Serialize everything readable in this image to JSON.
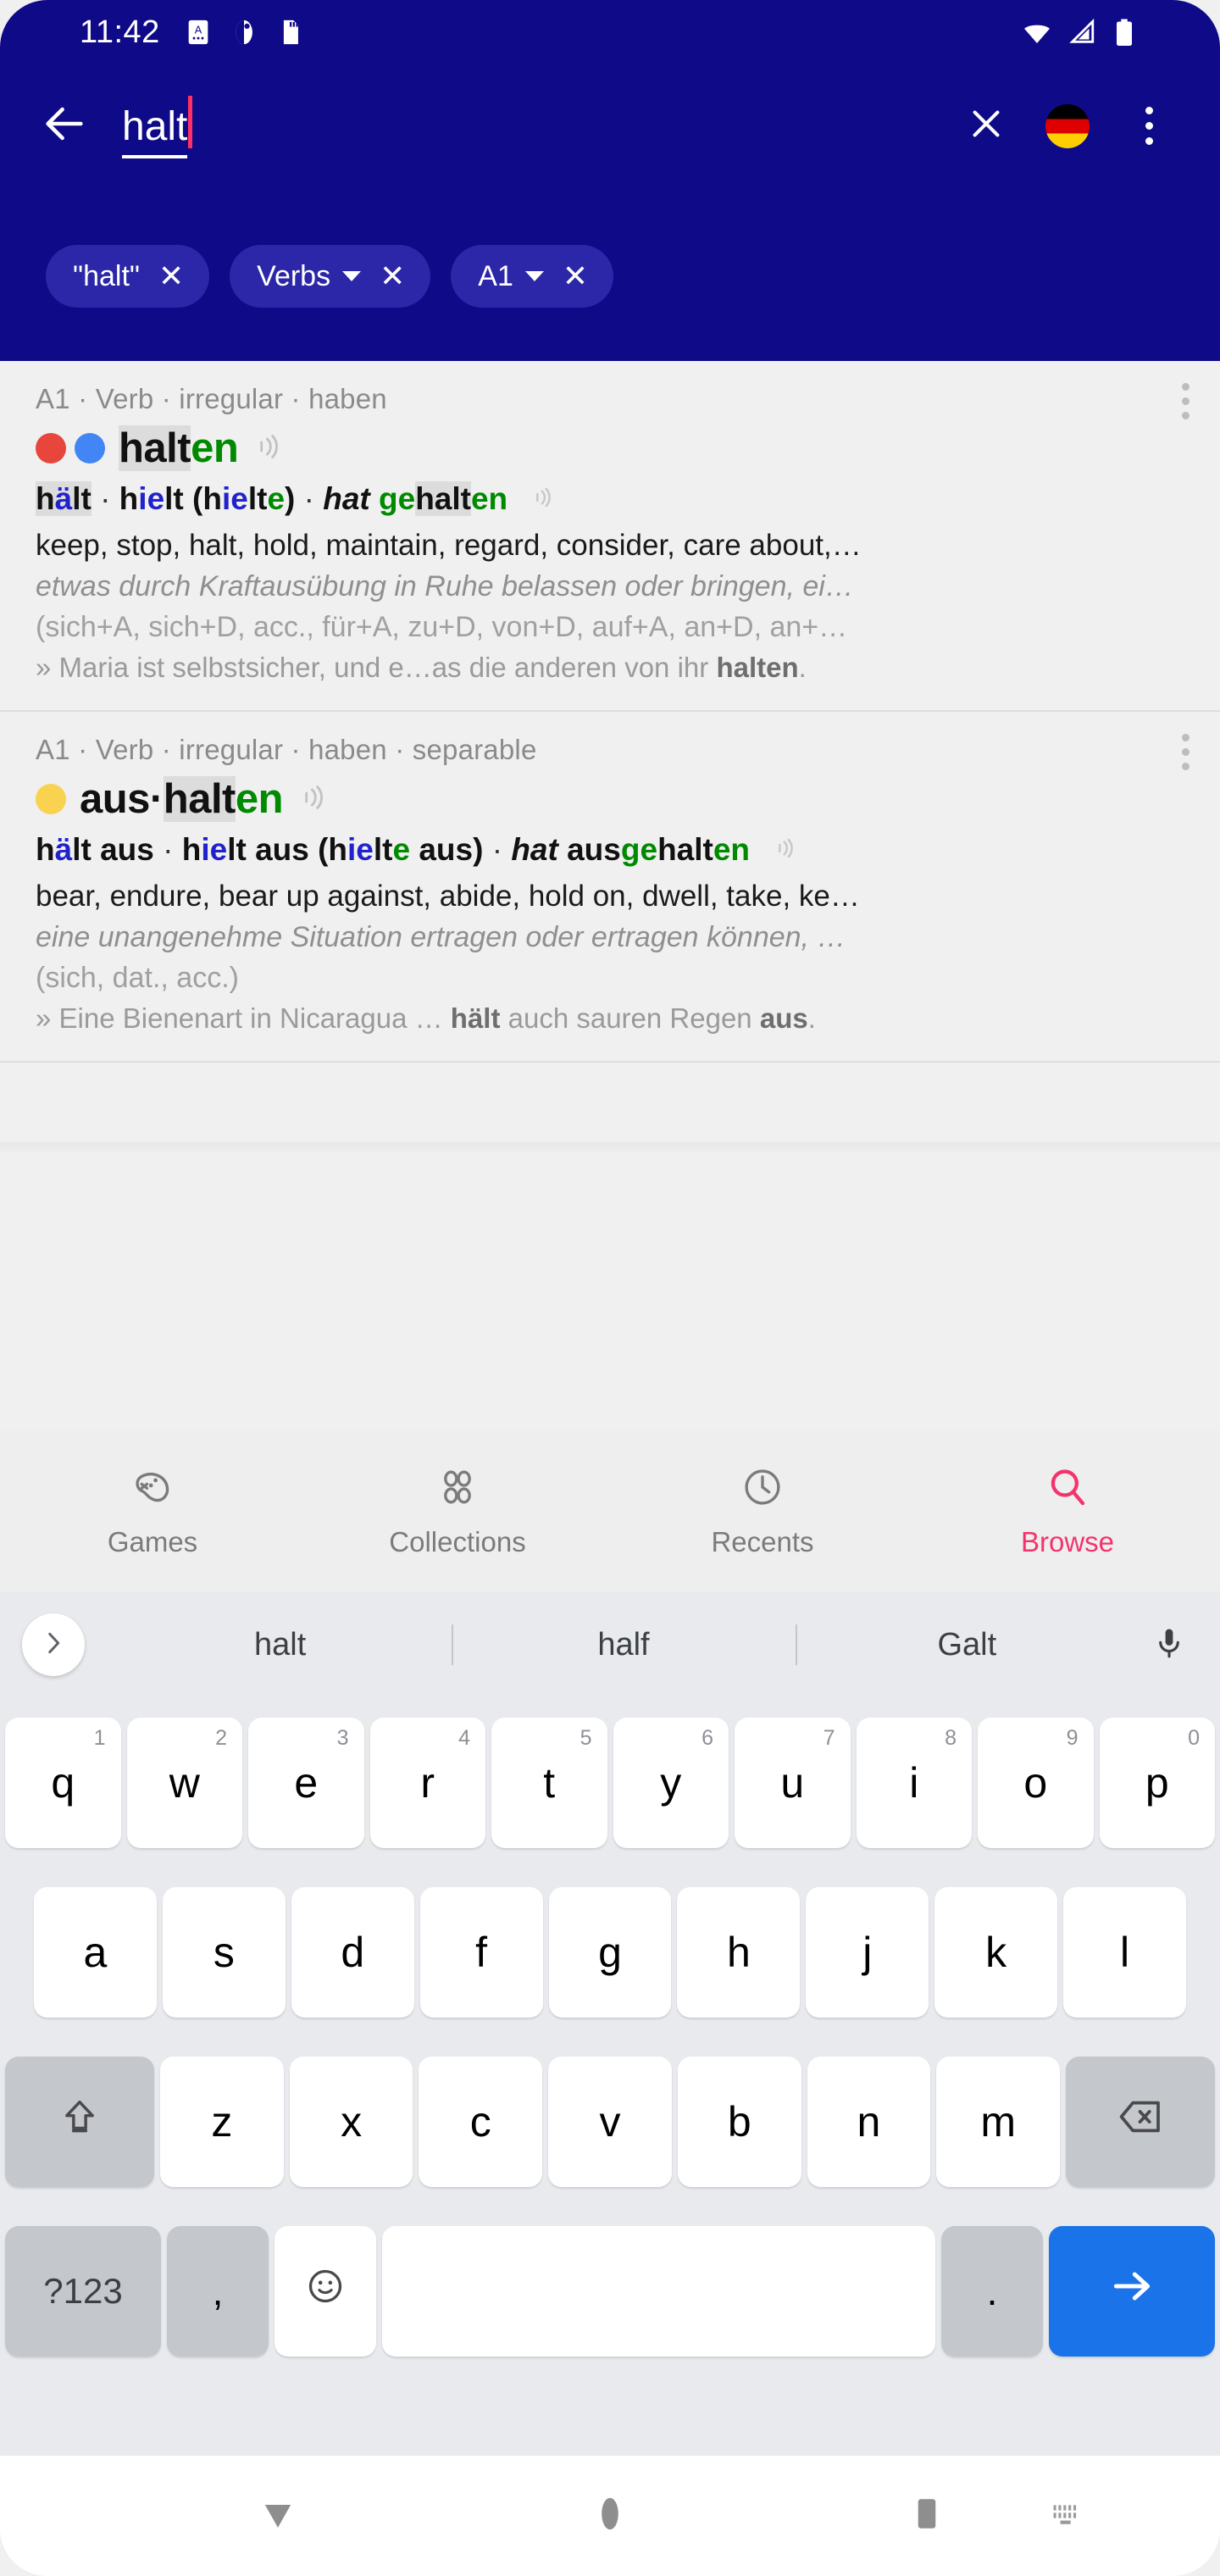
{
  "statusbar": {
    "time": "11:42",
    "left_icons": [
      "sd-card-a-icon",
      "mask-icon",
      "sim-card-icon"
    ],
    "right_icons": [
      "wifi-icon",
      "cellular-signal-icon",
      "battery-icon"
    ]
  },
  "appbar": {
    "back_icon": "back-arrow-icon",
    "query": "halt",
    "clear_icon": "close-icon",
    "language_icon": "german-flag-icon",
    "overflow_icon": "more-vertical-icon"
  },
  "filters": [
    {
      "label": "\"halt\"",
      "dropdown": false,
      "close": "✕"
    },
    {
      "label": "Verbs",
      "dropdown": true,
      "close": "✕"
    },
    {
      "label": "A1",
      "dropdown": true,
      "close": "✕"
    }
  ],
  "results": [
    {
      "meta": "A1 · Verb · irregular · haben",
      "dots": [
        "red",
        "blue"
      ],
      "headword_parts": [
        {
          "t": "halt",
          "hl": true
        },
        {
          "t": "en",
          "green": true
        }
      ],
      "headword_plain": "halten",
      "forms_html": "h<span class=\"b\">ä</span>lt · h<span class=\"b\">ie</span>lt (h<span class=\"b\">ie</span>lt<span class=\"g\">e</span>) · <span class=\"it\">hat</span> <span class=\"g\">ge</span>halt<span class=\"g\">en</span>",
      "translations": "keep, stop, halt, hold, maintain, regard, consider, care about,…",
      "definition": "etwas durch Kraftausübung in Ruhe belassen oder bringen, ei…",
      "cases": "(sich+A, sich+D, acc., für+A, zu+D, von+D, auf+A, an+D, an+…",
      "example_html": "» Maria ist selbstsicher, und e…as die anderen von ihr <b>halten</b>."
    },
    {
      "meta": "A1 · Verb · irregular · haben · separable",
      "dots": [
        "yellow"
      ],
      "headword_parts": [
        {
          "t": "aus·",
          "hl": false
        },
        {
          "t": "halt",
          "hl": true
        },
        {
          "t": "en",
          "green": true
        }
      ],
      "headword_plain": "aus·halten",
      "forms_html": "h<span class=\"b\">ä</span>lt aus · h<span class=\"b\">ie</span>lt aus (h<span class=\"b\">ie</span>lt<span class=\"g\">e</span> aus) · <span class=\"it\">hat</span> aus<span class=\"g\">ge</span>halt<span class=\"g\">en</span>",
      "translations": "bear, endure, bear up against, abide, hold on, dwell, take, ke…",
      "definition": "eine unangenehme Situation ertragen oder ertragen können, …",
      "cases": "(sich, dat., acc.)",
      "example_html": "» Eine Bienenart in Nicaragua … <b>hält</b> auch sauren Regen <b>aus</b>."
    }
  ],
  "bottomnav": {
    "items": [
      {
        "label": "Games",
        "icon": "gamepad-icon",
        "active": false
      },
      {
        "label": "Collections",
        "icon": "collections-icon",
        "active": false
      },
      {
        "label": "Recents",
        "icon": "clock-icon",
        "active": false
      },
      {
        "label": "Browse",
        "icon": "search-icon",
        "active": true
      }
    ],
    "active_color": "#f4336d",
    "inactive_color": "#7b7b7b"
  },
  "keyboard": {
    "expand_icon": "chevron-right-icon",
    "suggestions": [
      "halt",
      "half",
      "Galt"
    ],
    "mic_icon": "microphone-icon",
    "row1": [
      {
        "k": "q",
        "n": "1"
      },
      {
        "k": "w",
        "n": "2"
      },
      {
        "k": "e",
        "n": "3"
      },
      {
        "k": "r",
        "n": "4"
      },
      {
        "k": "t",
        "n": "5"
      },
      {
        "k": "y",
        "n": "6"
      },
      {
        "k": "u",
        "n": "7"
      },
      {
        "k": "i",
        "n": "8"
      },
      {
        "k": "o",
        "n": "9"
      },
      {
        "k": "p",
        "n": "0"
      }
    ],
    "row2": [
      "a",
      "s",
      "d",
      "f",
      "g",
      "h",
      "j",
      "k",
      "l"
    ],
    "row3": [
      "z",
      "x",
      "c",
      "v",
      "b",
      "n",
      "m"
    ],
    "shift_icon": "shift-icon",
    "backspace_icon": "backspace-icon",
    "sym_label": "?123",
    "comma_label": ",",
    "emoji_icon": "emoji-icon",
    "space_label": "",
    "period_label": ".",
    "enter_icon": "enter-arrow-icon"
  },
  "sysnav": {
    "back_icon": "nav-back-icon",
    "home_icon": "nav-home-icon",
    "recents_icon": "nav-recents-icon",
    "keyboard_icon": "nav-keyboard-icon"
  },
  "colors": {
    "appbar_bg": "#0f0a87",
    "chip_bg": "#2b27a8",
    "accent_pink": "#f4336d",
    "caret_pink": "#ff2e63",
    "green": "#008a00",
    "blue_vowel": "#2222cc",
    "enter_blue": "#1a73e8"
  }
}
